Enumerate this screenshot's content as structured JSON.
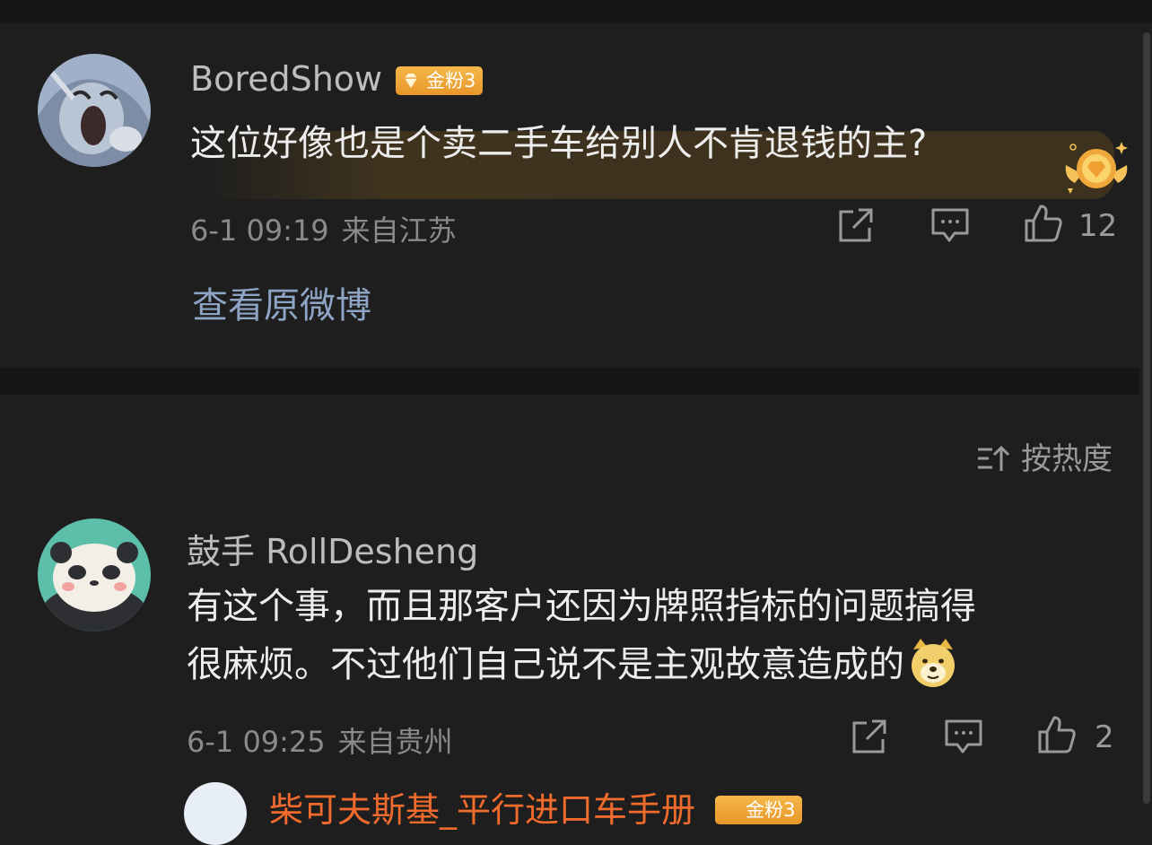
{
  "comments": [
    {
      "username": "BoredShow",
      "badge": "金粉3",
      "text": "这位好像也是个卖二手车给别人不肯退钱的主?",
      "time": "6-1 09:19",
      "location": "来自江苏",
      "likes": "12",
      "view_original": "查看原微博",
      "avatar_icon": "tom-cat-avatar",
      "special_icon": "gold-fan-medal-icon"
    },
    {
      "username": "鼓手 RollDesheng",
      "text_line1": "有这个事，而且那客户还因为牌照指标的问题搞得",
      "text_line2": "很麻烦。不过他们自己说不是主观故意造成的",
      "emoji": "doge-emoji",
      "time": "6-1 09:25",
      "location": "来自贵州",
      "likes": "2",
      "avatar_icon": "panda-avatar"
    }
  ],
  "sort": {
    "label": "按热度",
    "icon": "sort-icon"
  },
  "next_comment": {
    "username_partial": "柴可夫斯基_平行进口车手册",
    "badge": "金粉3"
  },
  "colors": {
    "background": "#1e1e1e",
    "link": "#8ea4c4",
    "badge": "#f0a63a",
    "username_highlight": "#f06b2c"
  }
}
